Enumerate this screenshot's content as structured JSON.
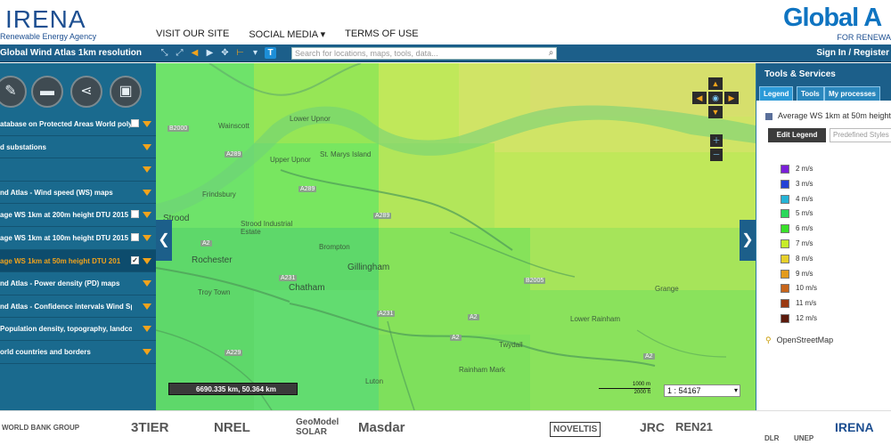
{
  "header": {
    "irena_logo_text": "IRENA",
    "irena_subtitle": "Renewable Energy Agency",
    "nav": [
      "VISIT OUR SITE",
      "SOCIAL MEDIA ▾",
      "TERMS OF USE"
    ],
    "global_atlas_logo_text": "Global A",
    "global_atlas_subtitle": "FOR RENEWA"
  },
  "toolbar": {
    "title": "Global Wind Atlas 1km resolution",
    "search_placeholder": "Search for locations, maps, tools, data...",
    "signin": "Sign In / Register"
  },
  "sidebar": {
    "buttons": [
      "pencil-icon",
      "folder-icon",
      "share-icon",
      "save-icon"
    ],
    "layers": [
      {
        "label": "atabase on Protected Areas World polygo",
        "checkbox": true,
        "checked": false,
        "active": false
      },
      {
        "label": "d substations",
        "checkbox": false,
        "checked": false,
        "active": false
      },
      {
        "label": "",
        "checkbox": false,
        "checked": false,
        "active": false
      },
      {
        "label": "nd Atlas - Wind speed (WS) maps",
        "checkbox": false,
        "checked": false,
        "active": false
      },
      {
        "label": "age WS 1km at 200m height DTU 2015",
        "checkbox": true,
        "checked": false,
        "active": false
      },
      {
        "label": "age WS 1km at 100m height DTU 2015",
        "checkbox": true,
        "checked": false,
        "active": false
      },
      {
        "label": "age WS 1km at 50m height DTU 201",
        "checkbox": true,
        "checked": true,
        "active": true
      },
      {
        "label": "nd Atlas - Power density (PD) maps",
        "checkbox": false,
        "checked": false,
        "active": false
      },
      {
        "label": "nd Atlas - Confidence intervals Wind Spe...",
        "checkbox": false,
        "checked": false,
        "active": false
      },
      {
        "label": "Population density, topography, landco...",
        "checkbox": false,
        "checked": false,
        "active": false
      },
      {
        "label": "orld countries and borders",
        "checkbox": false,
        "checked": false,
        "active": false
      }
    ]
  },
  "map": {
    "places": [
      {
        "name": "Lower Upnor",
        "kind": "village"
      },
      {
        "name": "Wainscott",
        "kind": "village"
      },
      {
        "name": "Upper Upnor",
        "kind": "village"
      },
      {
        "name": "St. Marys Island",
        "kind": "village"
      },
      {
        "name": "Frindsbury",
        "kind": "village"
      },
      {
        "name": "Strood",
        "kind": "town"
      },
      {
        "name": "Strood Industrial Estate",
        "kind": "area"
      },
      {
        "name": "Brompton",
        "kind": "village"
      },
      {
        "name": "Gillingham",
        "kind": "town"
      },
      {
        "name": "Rochester",
        "kind": "town"
      },
      {
        "name": "Troy Town",
        "kind": "village"
      },
      {
        "name": "Chatham",
        "kind": "town"
      },
      {
        "name": "Lower Rainham",
        "kind": "village"
      },
      {
        "name": "Twydall",
        "kind": "village"
      },
      {
        "name": "Rainham Mark",
        "kind": "village"
      },
      {
        "name": "Luton",
        "kind": "village"
      },
      {
        "name": "Grange",
        "kind": "village"
      }
    ],
    "roads": [
      "B2000",
      "A289",
      "A289",
      "A289",
      "A2",
      "A231",
      "A231",
      "A2",
      "B2005",
      "A229",
      "A2",
      "A2"
    ],
    "coordinates": "6690.335 km, 50.364 km",
    "scale_top": "1000 m",
    "scale_bottom": "2000 ft",
    "scale_ratio": "1 : 54167"
  },
  "right_panel": {
    "title": "Tools & Services",
    "tabs": [
      "Legend",
      "Tools",
      "My processes"
    ],
    "layer_title": "Average WS 1km at 50m height",
    "edit_legend": "Edit Legend",
    "styles_placeholder": "Predefined Styles",
    "legend": [
      {
        "label": "2 m/s",
        "color": "#7b1fd8"
      },
      {
        "label": "3 m/s",
        "color": "#2442d6"
      },
      {
        "label": "4 m/s",
        "color": "#25b3d6"
      },
      {
        "label": "5 m/s",
        "color": "#29d85a"
      },
      {
        "label": "6 m/s",
        "color": "#39e02a"
      },
      {
        "label": "7 m/s",
        "color": "#c7ec2a"
      },
      {
        "label": "8 m/s",
        "color": "#e6cf2a"
      },
      {
        "label": "9 m/s",
        "color": "#e39b1d"
      },
      {
        "label": "10 m/s",
        "color": "#c7651a"
      },
      {
        "label": "11 m/s",
        "color": "#9b3a12"
      },
      {
        "label": "12 m/s",
        "color": "#5c1a0c"
      }
    ],
    "basemap": "OpenStreetMap"
  },
  "footer": {
    "partners": [
      "WORLD BANK GROUP",
      "3TIER",
      "NREL",
      "GeoModel SOLAR",
      "Masdar",
      "NOVELTIS",
      "JRC",
      "REN21",
      "DLR",
      "UNEP",
      "IRENA"
    ]
  }
}
